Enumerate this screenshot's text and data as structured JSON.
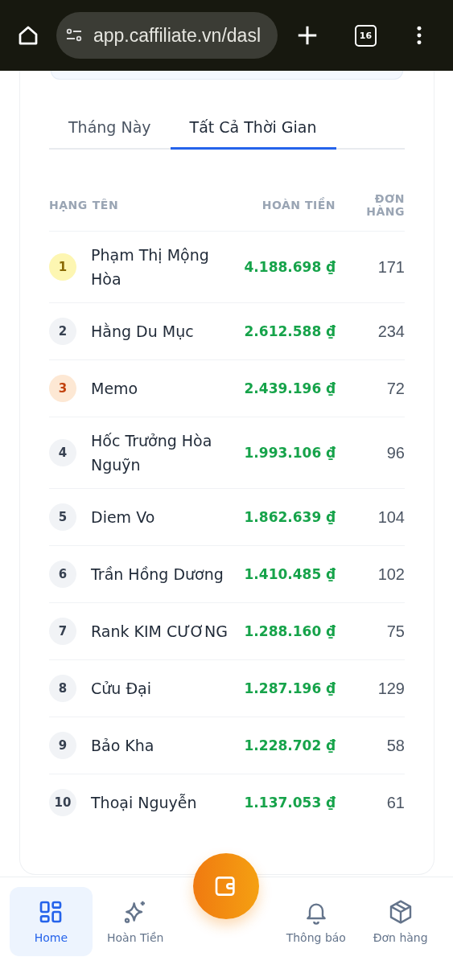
{
  "browser": {
    "url": "app.caffiliate.vn/dasl",
    "tab_count": "16"
  },
  "tabs": [
    {
      "label": "Tháng Này",
      "selected": false
    },
    {
      "label": "Tất Cả Thời Gian",
      "selected": true
    }
  ],
  "table": {
    "columns": [
      "HẠNG",
      "TÊN",
      "HOÀN TIỀN",
      "ĐƠN HÀNG"
    ],
    "rows": [
      {
        "rank": "1",
        "kind": "gold",
        "name": "Phạm Thị Mộng Hòa",
        "cashback": "4.188.698 ₫",
        "orders": "171"
      },
      {
        "rank": "2",
        "kind": "plain",
        "name": "Hằng Du Mục",
        "cashback": "2.612.588 ₫",
        "orders": "234"
      },
      {
        "rank": "3",
        "kind": "bronze",
        "name": "Memo",
        "cashback": "2.439.196 ₫",
        "orders": "72"
      },
      {
        "rank": "4",
        "kind": "plain",
        "name": "Hốc Trưởng Hòa Nguỹn",
        "cashback": "1.993.106 ₫",
        "orders": "96"
      },
      {
        "rank": "5",
        "kind": "plain",
        "name": "Diem Vo",
        "cashback": "1.862.639 ₫",
        "orders": "104"
      },
      {
        "rank": "6",
        "kind": "plain",
        "name": "Trần Hồng Dương",
        "cashback": "1.410.485 ₫",
        "orders": "102"
      },
      {
        "rank": "7",
        "kind": "plain",
        "name": "Rank KIM CƯƠNG",
        "cashback": "1.288.160 ₫",
        "orders": "75"
      },
      {
        "rank": "8",
        "kind": "plain",
        "name": "Cửu Đại",
        "cashback": "1.287.196 ₫",
        "orders": "129"
      },
      {
        "rank": "9",
        "kind": "plain",
        "name": "Bảo Kha",
        "cashback": "1.228.702 ₫",
        "orders": "58"
      },
      {
        "rank": "10",
        "kind": "plain",
        "name": "Thoại Nguyễn",
        "cashback": "1.137.053 ₫",
        "orders": "61"
      }
    ]
  },
  "bottom_nav": [
    {
      "kind": "item",
      "label": "Home",
      "selected": true
    },
    {
      "kind": "item",
      "label": "Hoàn Tiền",
      "selected": false
    },
    {
      "kind": "fab"
    },
    {
      "kind": "item",
      "label": "Thông báo",
      "selected": false
    },
    {
      "kind": "item",
      "label": "Đơn hàng",
      "selected": false
    }
  ]
}
